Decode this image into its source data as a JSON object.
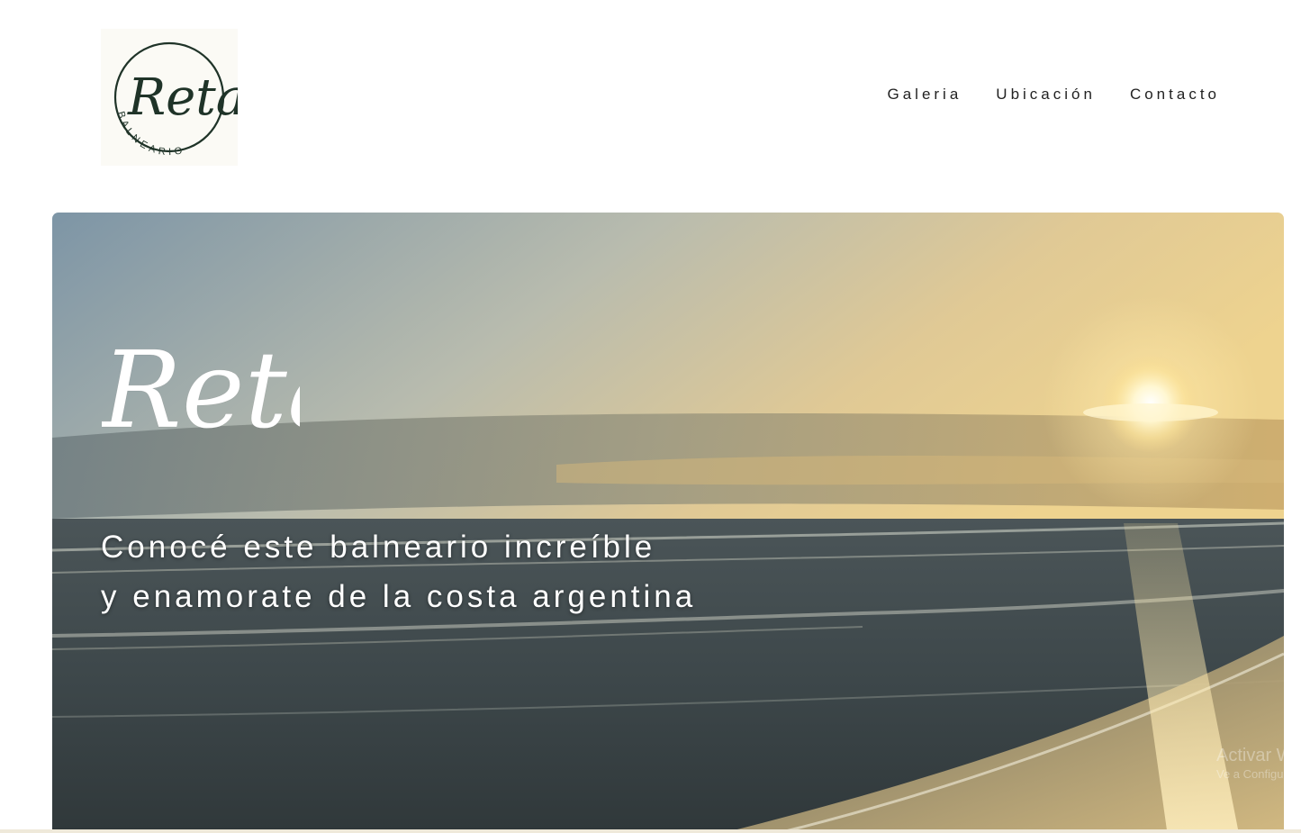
{
  "brand": {
    "logo_script": "Reta",
    "logo_ring_text": "BALNEARIO",
    "logo_color": "#1f3328"
  },
  "nav": {
    "items": [
      {
        "label": "Galeria"
      },
      {
        "label": "Ubicación"
      },
      {
        "label": "Contacto"
      }
    ]
  },
  "hero": {
    "script_title": "Reta",
    "line1": "Conocé este balneario increíble",
    "line2": "y enamorate de la costa argentina",
    "text_color": "#ffffff"
  },
  "watermark": {
    "line1": "Activar Win",
    "line2": "Ve a Configura"
  }
}
